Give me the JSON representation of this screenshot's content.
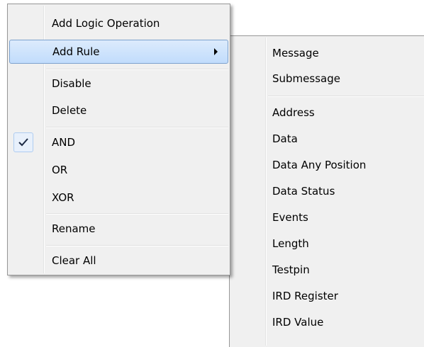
{
  "context_menu": {
    "items": [
      {
        "label": "Add Logic Operation"
      },
      {
        "label": "Add Rule"
      },
      {
        "label": "Disable"
      },
      {
        "label": "Delete"
      },
      {
        "label": "AND",
        "checked": true
      },
      {
        "label": "OR"
      },
      {
        "label": "XOR"
      },
      {
        "label": "Rename"
      },
      {
        "label": "Clear All"
      }
    ],
    "highlighted_item": "Add Rule"
  },
  "submenu": {
    "items": [
      {
        "label": "Message"
      },
      {
        "label": "Submessage"
      },
      {
        "label": "Address"
      },
      {
        "label": "Data"
      },
      {
        "label": "Data Any Position"
      },
      {
        "label": "Data Status"
      },
      {
        "label": "Events"
      },
      {
        "label": "Length"
      },
      {
        "label": "Testpin"
      },
      {
        "label": "IRD Register"
      },
      {
        "label": "IRD Value"
      }
    ]
  },
  "icons": {
    "submenu_arrow": "chevron-right-icon",
    "check_mark": "checkmark-icon"
  },
  "colors": {
    "menu_background": "#f0f0f0",
    "highlight_border": "#7da2ce",
    "highlight_fill": "#c1dcfc"
  }
}
